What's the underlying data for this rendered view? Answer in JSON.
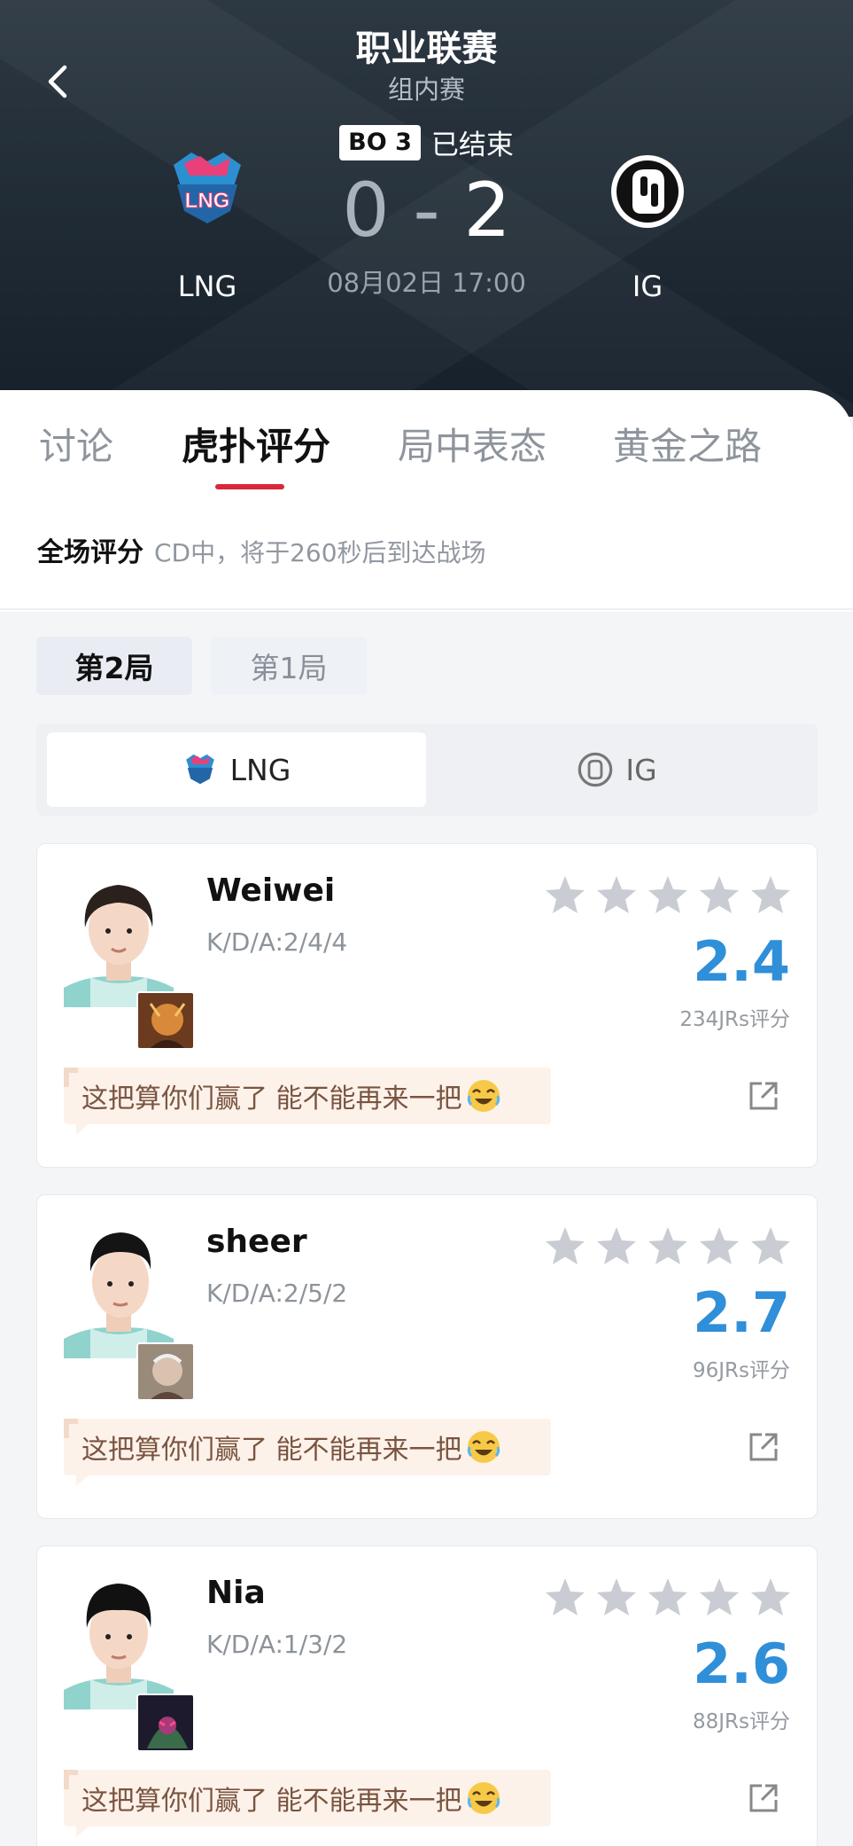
{
  "header": {
    "title": "职业联赛",
    "subtitle": "组内赛",
    "bo_badge": "BO 3",
    "status": "已结束",
    "score_left": "0",
    "score_sep": " - ",
    "score_right": "2",
    "date": "08月02日 17:00",
    "team_left": "LNG",
    "team_right": "IG"
  },
  "tabs": [
    "讨论",
    "虎扑评分",
    "局中表态",
    "黄金之路"
  ],
  "active_tab": "虎扑评分",
  "notice": {
    "label": "全场评分",
    "message": "CD中，将于260秒后到达战场"
  },
  "game_tabs": [
    "第2局",
    "第1局"
  ],
  "team_switch": [
    "LNG",
    "IG"
  ],
  "players": [
    {
      "name": "Weiwei",
      "kda": "K/D/A:2/4/4",
      "rating": "2.4",
      "votes": "234JRs评分",
      "comment": "这把算你们赢了  能不能再来一把"
    },
    {
      "name": "sheer",
      "kda": "K/D/A:2/5/2",
      "rating": "2.7",
      "votes": "96JRs评分",
      "comment": "这把算你们赢了  能不能再来一把"
    },
    {
      "name": "Nia",
      "kda": "K/D/A:1/3/2",
      "rating": "2.6",
      "votes": "88JRs评分",
      "comment": "这把算你们赢了  能不能再来一把"
    }
  ],
  "colors": {
    "accent_red": "#d8283a",
    "rating_blue": "#2f8fd8",
    "star_gray": "#c9ccd2"
  },
  "icons": [
    "back-icon",
    "lng-logo",
    "ig-logo",
    "star-icon",
    "share-icon",
    "laughing-crying-emoji"
  ]
}
